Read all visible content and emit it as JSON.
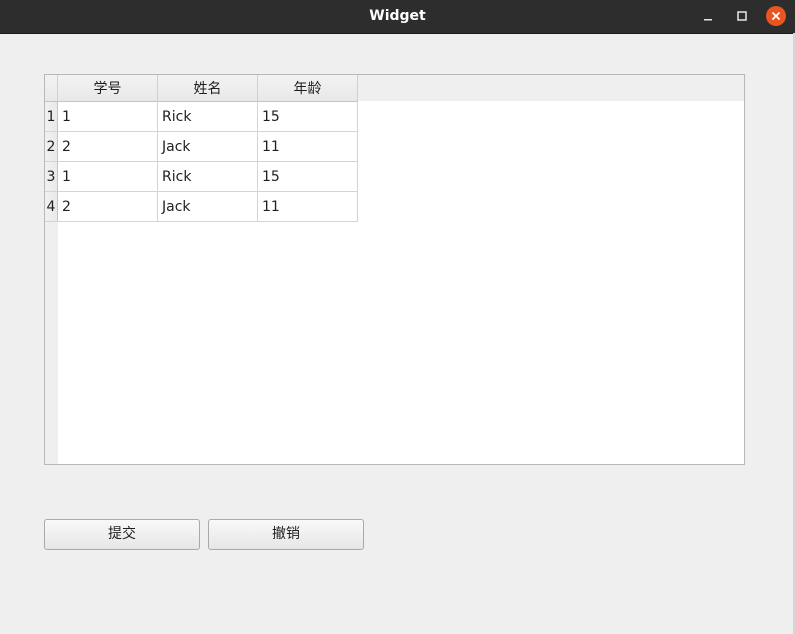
{
  "window": {
    "title": "Widget"
  },
  "table": {
    "headers": [
      "学号",
      "姓名",
      "年龄"
    ],
    "rows": [
      {
        "num": "1",
        "cells": [
          "1",
          "Rick",
          "15"
        ]
      },
      {
        "num": "2",
        "cells": [
          "2",
          "Jack",
          "11"
        ]
      },
      {
        "num": "3",
        "cells": [
          "1",
          "Rick",
          "15"
        ]
      },
      {
        "num": "4",
        "cells": [
          "2",
          "Jack",
          "11"
        ]
      }
    ]
  },
  "buttons": {
    "submit_label": "提交",
    "cancel_label": "撤销"
  },
  "icons": {
    "minimize": "minimize-icon",
    "maximize": "maximize-icon",
    "close": "close-icon"
  },
  "colors": {
    "titlebar": "#2d2d2d",
    "close_button": "#e95420"
  }
}
